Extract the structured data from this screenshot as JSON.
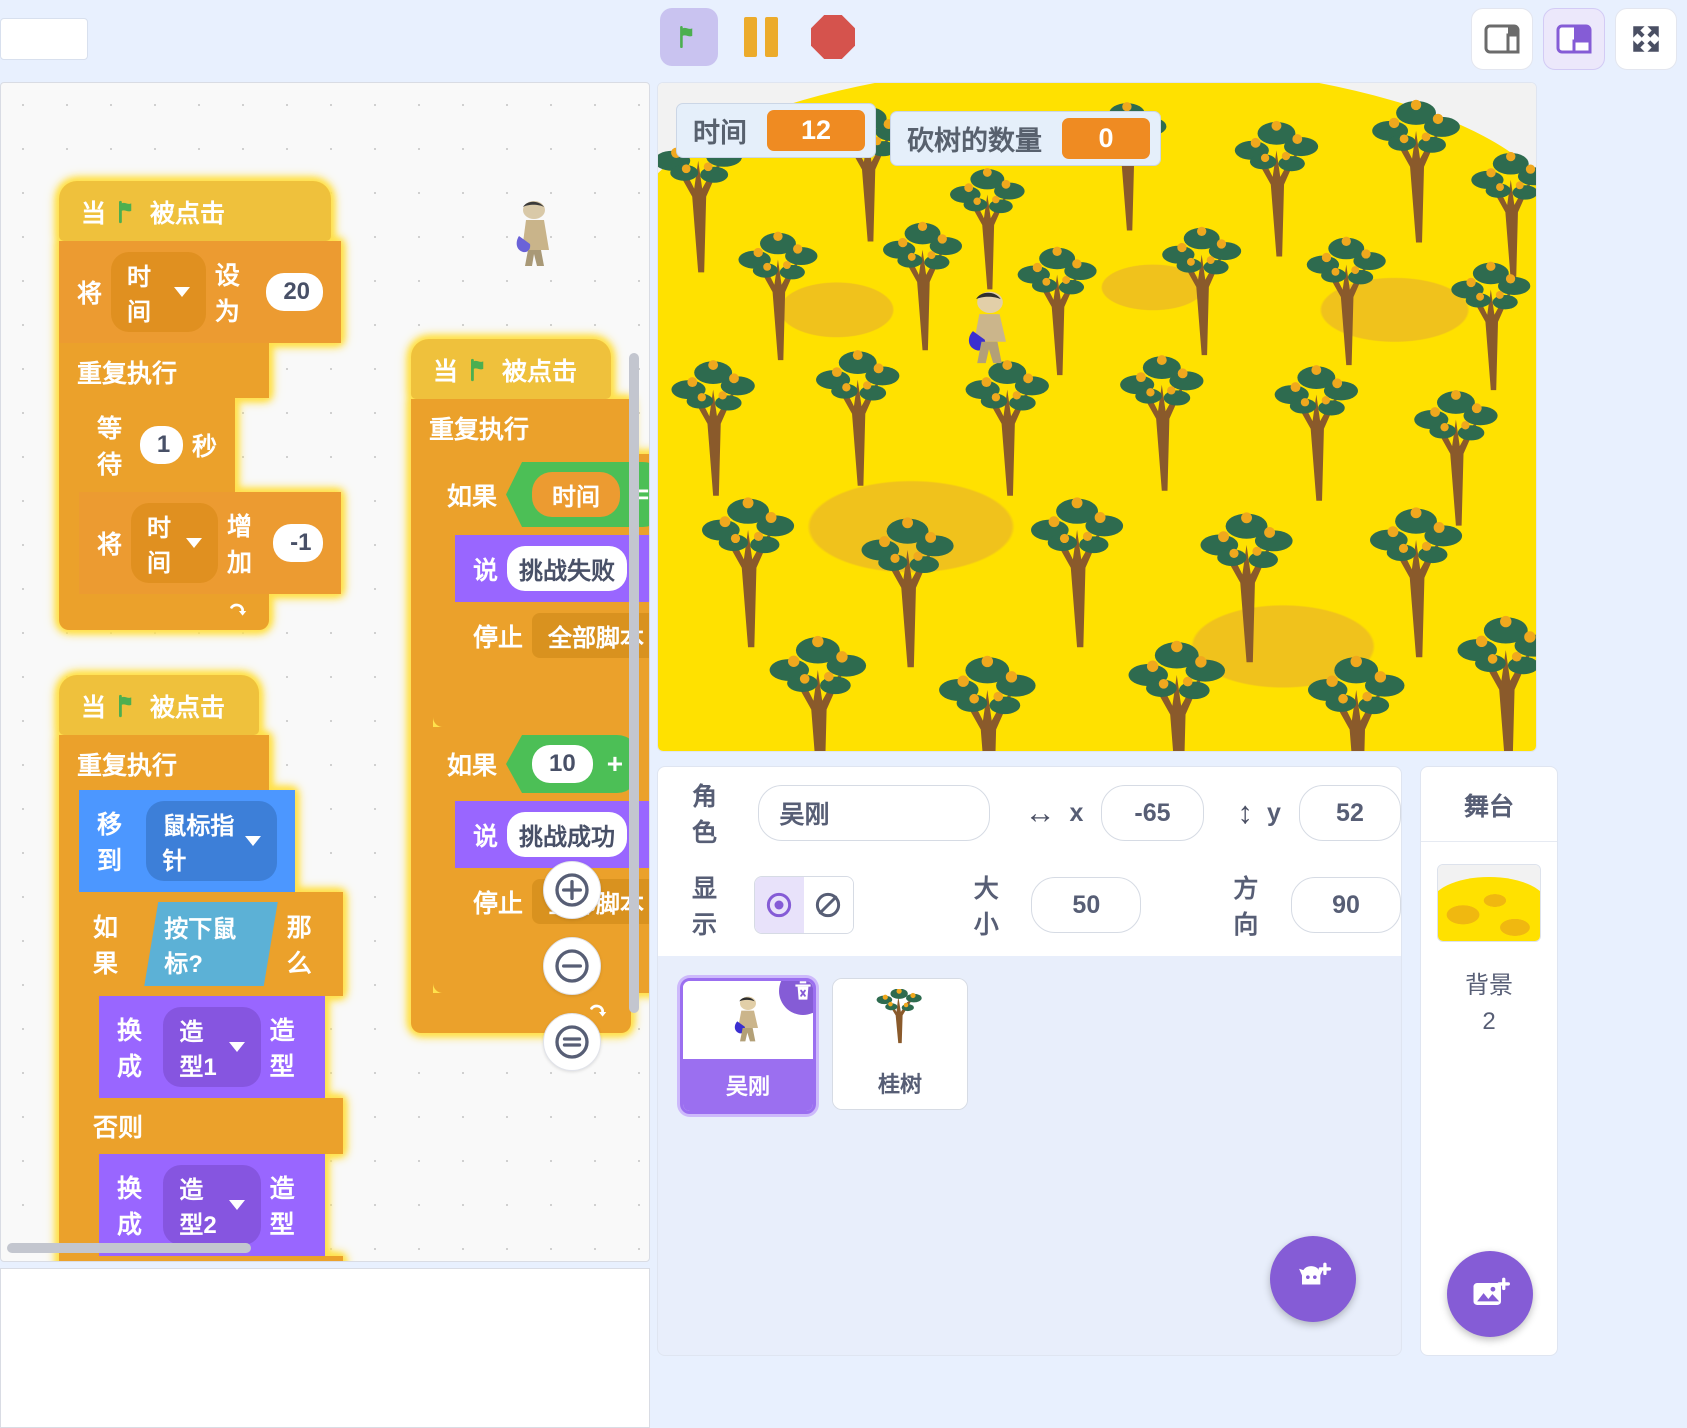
{
  "toolbar": {
    "green_flag": "green-flag",
    "pause": "pause",
    "stop": "stop",
    "layout_small": "small-stage-layout",
    "layout_large": "large-stage-layout",
    "fullscreen": "fullscreen"
  },
  "stage": {
    "watchers": [
      {
        "name": "时间",
        "value": "12"
      },
      {
        "name": "砍树的数量",
        "value": "0"
      }
    ]
  },
  "sprite_info": {
    "name_label": "角色",
    "name_value": "吴刚",
    "x_label": "x",
    "x_value": "-65",
    "y_label": "y",
    "y_value": "52",
    "show_label": "显示",
    "size_label": "大小",
    "size_value": "50",
    "direction_label": "方向",
    "direction_value": "90"
  },
  "sprites": [
    {
      "name": "吴刚",
      "selected": true
    },
    {
      "name": "桂树",
      "selected": false
    }
  ],
  "stage_panel": {
    "title": "舞台",
    "backdrop_label": "背景",
    "backdrop_count": "2"
  },
  "zoom_controls": {
    "zoom_in": "+",
    "zoom_out": "−",
    "zoom_reset": "="
  },
  "add_buttons": {
    "add_sprite": "add-sprite",
    "add_backdrop": "add-backdrop"
  },
  "scripts": [
    {
      "id": "script-timer",
      "hat": {
        "pre": "当",
        "post": "被点击"
      },
      "blocks": [
        {
          "type": "set-var",
          "words": [
            "将",
            "设为"
          ],
          "var": "时间",
          "value": "20"
        },
        {
          "type": "forever",
          "label": "重复执行",
          "children": [
            {
              "type": "wait",
              "words": [
                "等待",
                "秒"
              ],
              "value": "1"
            },
            {
              "type": "change-var",
              "words": [
                "将",
                "增加"
              ],
              "var": "时间",
              "value": "-1"
            }
          ]
        }
      ]
    },
    {
      "id": "script-follow-mouse",
      "hat": {
        "pre": "当",
        "post": "被点击"
      },
      "blocks": [
        {
          "type": "forever",
          "label": "重复执行",
          "children": [
            {
              "type": "goto",
              "words": [
                "移到"
              ],
              "target": "鼠标指针"
            },
            {
              "type": "if-else",
              "words": [
                "如果",
                "那么",
                "否则"
              ],
              "cond": "按下鼠标?",
              "then": [
                {
                  "type": "switch-costume",
                  "words": [
                    "换成",
                    "造型"
                  ],
                  "value": "造型1"
                }
              ],
              "else": [
                {
                  "type": "switch-costume",
                  "words": [
                    "换成",
                    "造型"
                  ],
                  "value": "造型2"
                }
              ]
            }
          ]
        }
      ]
    },
    {
      "id": "script-win-lose",
      "hat": {
        "pre": "当",
        "post": "被点击"
      },
      "blocks": [
        {
          "type": "forever",
          "label": "重复执行",
          "children": [
            {
              "type": "if",
              "words": [
                "如果"
              ],
              "cond_left": "时间",
              "cond_op": "=",
              "body": [
                {
                  "type": "say",
                  "words": [
                    "说"
                  ],
                  "value": "挑战失败"
                },
                {
                  "type": "stop",
                  "words": [
                    "停止"
                  ],
                  "value": "全部脚本"
                }
              ]
            },
            {
              "type": "if",
              "words": [
                "如果"
              ],
              "cond_left": "10",
              "cond_op": "+",
              "body": [
                {
                  "type": "say",
                  "words": [
                    "说"
                  ],
                  "value": "挑战成功"
                },
                {
                  "type": "stop",
                  "words": [
                    "停止"
                  ],
                  "value": "全部脚本"
                }
              ]
            }
          ]
        }
      ]
    }
  ],
  "colors": {
    "events": "#efc13c",
    "control": "#eba12b",
    "variables": "#ec9b31",
    "looks": "#9966ff",
    "motion": "#4c97ff",
    "operators": "#4cbf56",
    "sensing": "#5cb1d6",
    "accent": "#855cd6",
    "watcher_value": "#ef8b22",
    "glow": "#ffe14d"
  }
}
